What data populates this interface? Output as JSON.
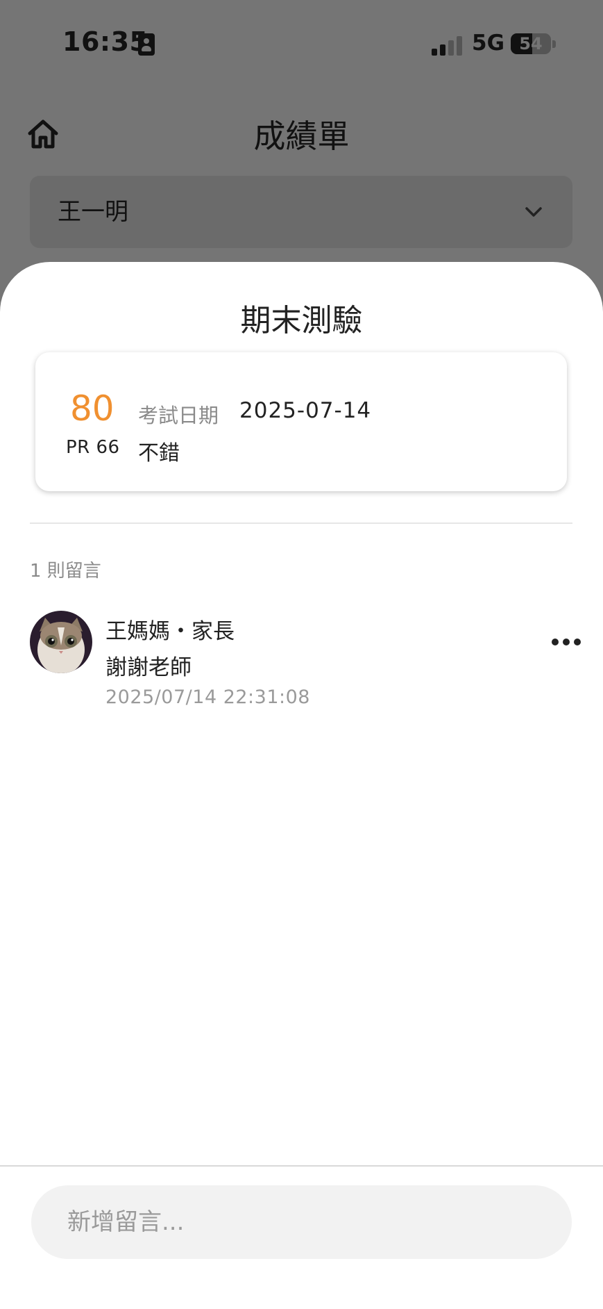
{
  "status_bar": {
    "time": "16:35",
    "network": "5G",
    "battery_level": "54",
    "battery_fraction": 0.54,
    "signal_bars_filled": 2,
    "signal_bars_total": 4
  },
  "header": {
    "title": "成績單",
    "home_icon": "home-icon"
  },
  "student_select": {
    "value": "王一明",
    "icon": "chevron-down-icon"
  },
  "sheet": {
    "title": "期末測驗",
    "score_card": {
      "score": "80",
      "pr": "PR 66",
      "date_label": "考試日期",
      "date_value": "2025-07-14",
      "remark": "不錯"
    },
    "comment_count": "1 則留言",
    "comments": [
      {
        "author": "王媽媽・家長",
        "text": "謝謝老師",
        "time": "2025/07/14 22:31:08",
        "more_icon": "more-horizontal-icon"
      }
    ]
  },
  "comment_input": {
    "placeholder": "新增留言..."
  },
  "colors": {
    "backdrop": "#757575",
    "score_accent": "#f09030",
    "sheet_background": "#ffffff",
    "input_background": "#f2f2f2"
  }
}
